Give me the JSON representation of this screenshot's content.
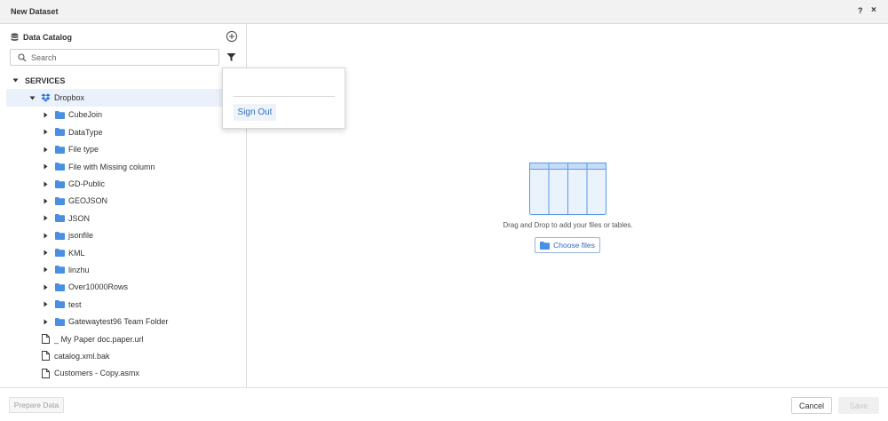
{
  "window": {
    "title": "New Dataset",
    "help_label": "?",
    "close_label": "×"
  },
  "catalog": {
    "title": "Data Catalog",
    "search_placeholder": "Search"
  },
  "tree": {
    "services_label": "SERVICES",
    "dropbox_label": "Dropbox",
    "folders": [
      "CubeJoin",
      "DataType",
      "File type",
      "File with Missing column",
      "GD-Public",
      "GEOJSON",
      "JSON",
      "jsonfile",
      "KML",
      "linzhu",
      "Over10000Rows",
      "test",
      "Gatewaytest96 Team Folder"
    ],
    "files": [
      "_ My Paper doc.paper.url",
      "catalog.xml.bak",
      "Customers - Copy.asmx"
    ]
  },
  "popup": {
    "sign_out_label": "Sign Out"
  },
  "dropzone": {
    "text": "Drag and Drop to add your files or tables.",
    "choose_label": "Choose files"
  },
  "footer": {
    "prepare_label": "Prepare Data",
    "cancel_label": "Cancel",
    "save_label": "Save"
  },
  "colors": {
    "accent": "#2f6fc0",
    "folder": "#4a90e2",
    "dropbox": "#1e6fe0",
    "selection": "#eaf1fb"
  }
}
